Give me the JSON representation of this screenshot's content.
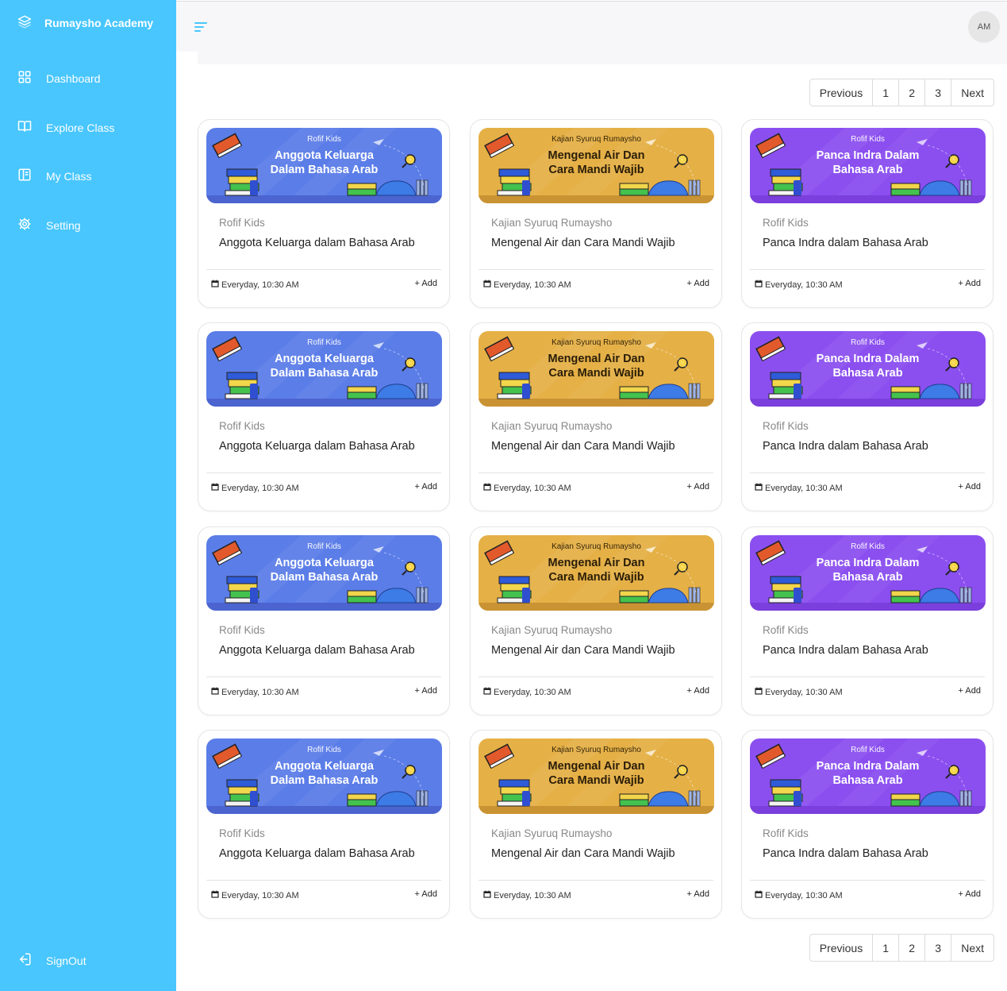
{
  "brand": {
    "name": "Rumaysho Academy"
  },
  "sidebar": {
    "items": [
      {
        "label": "Dashboard",
        "icon": "dashboard-icon"
      },
      {
        "label": "Explore Class",
        "icon": "book-open-icon"
      },
      {
        "label": "My Class",
        "icon": "notebook-icon"
      },
      {
        "label": "Setting",
        "icon": "gear-icon"
      }
    ],
    "signout_label": "SignOut"
  },
  "topbar": {
    "avatar_initials": "AM"
  },
  "pagination": {
    "previous": "Previous",
    "pages": [
      "1",
      "2",
      "3"
    ],
    "next": "Next"
  },
  "colors": {
    "sidebar": "#48c6fd",
    "blue_banner": "#5b7de8",
    "orange_banner": "#e5b046",
    "purple_banner": "#8b4ff0"
  },
  "courses": [
    {
      "banner_color": "blue",
      "banner_sub": "Rofif Kids",
      "banner_title": "Anggota Keluarga Dalam Bahasa Arab",
      "category": "Rofif Kids",
      "title": "Anggota Keluarga dalam Bahasa Arab",
      "schedule": "Everyday, 10:30 AM",
      "add_label": "+ Add"
    },
    {
      "banner_color": "orange",
      "banner_sub": "Kajian Syuruq Rumaysho",
      "banner_title": "Mengenal Air Dan Cara Mandi Wajib",
      "category": "Kajian Syuruq Rumaysho",
      "title": "Mengenal Air dan Cara Mandi Wajib",
      "schedule": "Everyday, 10:30 AM",
      "add_label": "+ Add"
    },
    {
      "banner_color": "purple",
      "banner_sub": "Rofif Kids",
      "banner_title": "Panca Indra Dalam Bahasa Arab",
      "category": "Rofif Kids",
      "title": "Panca Indra dalam Bahasa Arab",
      "schedule": "Everyday, 10:30 AM",
      "add_label": "+ Add"
    },
    {
      "banner_color": "blue",
      "banner_sub": "Rofif Kids",
      "banner_title": "Anggota Keluarga Dalam Bahasa Arab",
      "category": "Rofif Kids",
      "title": "Anggota Keluarga dalam Bahasa Arab",
      "schedule": "Everyday, 10:30 AM",
      "add_label": "+ Add"
    },
    {
      "banner_color": "orange",
      "banner_sub": "Kajian Syuruq Rumaysho",
      "banner_title": "Mengenal Air Dan Cara Mandi Wajib",
      "category": "Kajian Syuruq Rumaysho",
      "title": "Mengenal Air dan Cara Mandi Wajib",
      "schedule": "Everyday, 10:30 AM",
      "add_label": "+ Add"
    },
    {
      "banner_color": "purple",
      "banner_sub": "Rofif Kids",
      "banner_title": "Panca Indra Dalam Bahasa Arab",
      "category": "Rofif Kids",
      "title": "Panca Indra dalam Bahasa Arab",
      "schedule": "Everyday, 10:30 AM",
      "add_label": "+ Add"
    },
    {
      "banner_color": "blue",
      "banner_sub": "Rofif Kids",
      "banner_title": "Anggota Keluarga Dalam Bahasa Arab",
      "category": "Rofif Kids",
      "title": "Anggota Keluarga dalam Bahasa Arab",
      "schedule": "Everyday, 10:30 AM",
      "add_label": "+ Add"
    },
    {
      "banner_color": "orange",
      "banner_sub": "Kajian Syuruq Rumaysho",
      "banner_title": "Mengenal Air Dan Cara Mandi Wajib",
      "category": "Kajian Syuruq Rumaysho",
      "title": "Mengenal Air dan Cara Mandi Wajib",
      "schedule": "Everyday, 10:30 AM",
      "add_label": "+ Add"
    },
    {
      "banner_color": "purple",
      "banner_sub": "Rofif Kids",
      "banner_title": "Panca Indra Dalam Bahasa Arab",
      "category": "Rofif Kids",
      "title": "Panca Indra dalam Bahasa Arab",
      "schedule": "Everyday, 10:30 AM",
      "add_label": "+ Add"
    },
    {
      "banner_color": "blue",
      "banner_sub": "Rofif Kids",
      "banner_title": "Anggota Keluarga Dalam Bahasa Arab",
      "category": "Rofif Kids",
      "title": "Anggota Keluarga dalam Bahasa Arab",
      "schedule": "Everyday, 10:30 AM",
      "add_label": "+ Add"
    },
    {
      "banner_color": "orange",
      "banner_sub": "Kajian Syuruq Rumaysho",
      "banner_title": "Mengenal Air Dan Cara Mandi Wajib",
      "category": "Kajian Syuruq Rumaysho",
      "title": "Mengenal Air dan Cara Mandi Wajib",
      "schedule": "Everyday, 10:30 AM",
      "add_label": "+ Add"
    },
    {
      "banner_color": "purple",
      "banner_sub": "Rofif Kids",
      "banner_title": "Panca Indra Dalam Bahasa Arab",
      "category": "Rofif Kids",
      "title": "Panca Indra dalam Bahasa Arab",
      "schedule": "Everyday, 10:30 AM",
      "add_label": "+ Add"
    }
  ]
}
